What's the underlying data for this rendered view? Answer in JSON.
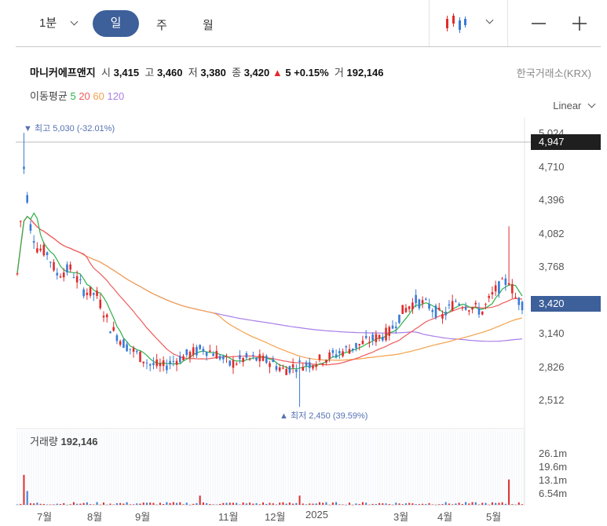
{
  "toolbar": {
    "interval": "1분",
    "periods": [
      "일",
      "주",
      "월"
    ],
    "selected_period": "일"
  },
  "stock": {
    "name": "마니커에프앤지",
    "open_label": "시",
    "open": "3,415",
    "high_label": "고",
    "high": "3,460",
    "low_label": "저",
    "low": "3,380",
    "close_label": "종",
    "close": "3,420",
    "change_arrow": "▲",
    "change": "5",
    "change_pct": "+0.15%",
    "volume_label": "거",
    "volume": "192,146",
    "exchange": "한국거래소(KRX)"
  },
  "ma": {
    "label": "이동평균",
    "periods": [
      {
        "label": "5",
        "color": "#2cb14a"
      },
      {
        "label": "20",
        "color": "#ef5a5a"
      },
      {
        "label": "60",
        "color": "#f5a04a"
      },
      {
        "label": "120",
        "color": "#a97de6"
      }
    ]
  },
  "scale_mode": "Linear",
  "colors": {
    "up": "#e02c2c",
    "down": "#3a7bd5",
    "accent": "#3d5f9a"
  },
  "chart_data": {
    "type": "candlestick",
    "y_ticks": [
      "5,024",
      "4,710",
      "4,396",
      "4,082",
      "3,768",
      "3,140",
      "2,826",
      "2,512"
    ],
    "ylim": [
      2400,
      5150
    ],
    "x_ticks": [
      "7월",
      "8월",
      "9월",
      "11월",
      "12월",
      "2025",
      "3월",
      "4월",
      "5월"
    ],
    "highest": {
      "label": "▼ 최고 5,030 (-32.01%)",
      "value": 5030
    },
    "lowest": {
      "label": "▲ 최저 2,450 (39.59%)",
      "value": 2450
    },
    "current_price": {
      "label": "3,420",
      "value": 3420
    },
    "crosshair_price": {
      "label": "4,947",
      "value": 4947
    },
    "volume": {
      "title": "거래량",
      "value": "192,146",
      "ticks": [
        "26.1m",
        "19.6m",
        "13.1m",
        "6.54m"
      ],
      "max": 30000000
    },
    "price_anchors": [
      [
        0,
        3700
      ],
      [
        2,
        4700
      ],
      [
        4,
        4150
      ],
      [
        6,
        3950
      ],
      [
        9,
        3900
      ],
      [
        12,
        3700
      ],
      [
        16,
        3750
      ],
      [
        20,
        3550
      ],
      [
        24,
        3500
      ],
      [
        28,
        3200
      ],
      [
        32,
        3050
      ],
      [
        36,
        2950
      ],
      [
        40,
        2850
      ],
      [
        44,
        2830
      ],
      [
        48,
        2900
      ],
      [
        52,
        2950
      ],
      [
        56,
        3000
      ],
      [
        60,
        2950
      ],
      [
        64,
        2850
      ],
      [
        68,
        2900
      ],
      [
        72,
        2900
      ],
      [
        76,
        2880
      ],
      [
        80,
        2800
      ],
      [
        84,
        2840
      ],
      [
        88,
        2860
      ],
      [
        92,
        2900
      ],
      [
        96,
        2950
      ],
      [
        100,
        3000
      ],
      [
        104,
        3050
      ],
      [
        108,
        3100
      ],
      [
        112,
        3150
      ],
      [
        116,
        3350
      ],
      [
        120,
        3450
      ],
      [
        124,
        3400
      ],
      [
        128,
        3300
      ],
      [
        132,
        3450
      ],
      [
        136,
        3400
      ],
      [
        140,
        3350
      ],
      [
        144,
        3550
      ],
      [
        148,
        3650
      ],
      [
        150,
        3480
      ],
      [
        152,
        3420
      ]
    ]
  }
}
